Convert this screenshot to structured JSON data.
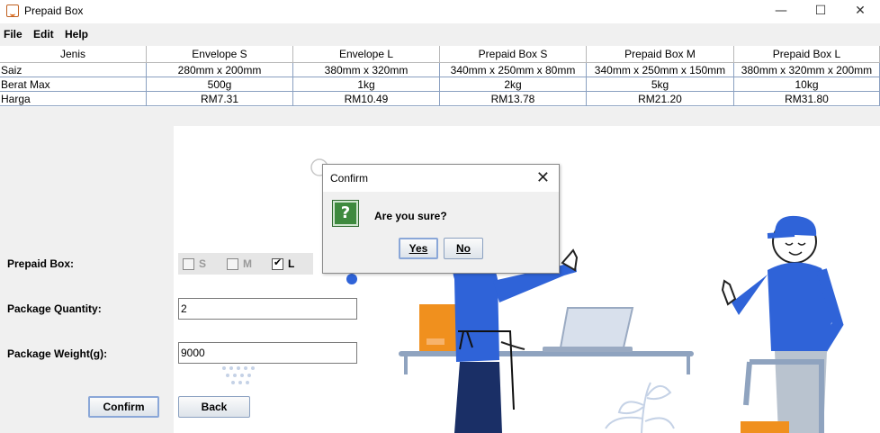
{
  "window": {
    "title": "Prepaid Box",
    "minimize": "—",
    "maximize": "☐",
    "close": "✕"
  },
  "menu": [
    "File",
    "Edit",
    "Help"
  ],
  "table": {
    "headers": [
      "Jenis",
      "Envelope S",
      "Envelope L",
      "Prepaid Box S",
      "Prepaid Box M",
      "Prepaid Box L"
    ],
    "rows": [
      [
        "Saiz",
        "280mm x 200mm",
        "380mm x 320mm",
        "340mm x 250mm x 80mm",
        "340mm x 250mm x 150mm",
        "380mm x 320mm x 200mm"
      ],
      [
        "Berat Max",
        "500g",
        "1kg",
        "2kg",
        "5kg",
        "10kg"
      ],
      [
        "Harga",
        "RM7.31",
        "RM10.49",
        "RM13.78",
        "RM21.20",
        "RM31.80"
      ]
    ]
  },
  "form": {
    "prepaid_box_label": "Prepaid Box:",
    "options": [
      {
        "label": "S",
        "checked": false
      },
      {
        "label": "M",
        "checked": false
      },
      {
        "label": "L",
        "checked": true
      }
    ],
    "quantity_label": "Package Quantity:",
    "quantity_value": "2",
    "weight_label": "Package Weight(g):",
    "weight_value": "9000",
    "confirm_label": "Confirm",
    "back_label": "Back"
  },
  "dialog": {
    "title": "Confirm",
    "close": "✕",
    "icon": "?",
    "message": "Are you sure?",
    "yes_label": "Yes",
    "no_label": "No"
  },
  "colors": {
    "accent": "#2f63d8",
    "shirt": "#2f63d8",
    "box": "#f0901e",
    "button_border": "#8aa0c0"
  }
}
